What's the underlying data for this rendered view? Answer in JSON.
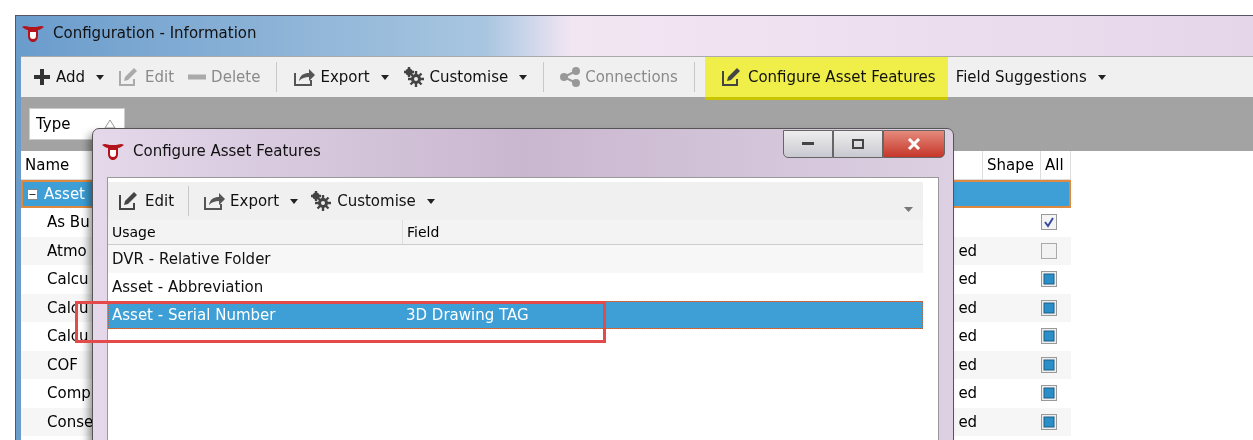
{
  "main_window": {
    "title": "Configuration - Information",
    "toolbar": [
      {
        "kind": "add",
        "label": "Add",
        "dropdown": true,
        "disabled": false,
        "highlighted": false
      },
      {
        "kind": "edit",
        "label": "Edit",
        "dropdown": false,
        "disabled": true,
        "highlighted": false
      },
      {
        "kind": "delete",
        "label": "Delete",
        "dropdown": false,
        "disabled": true,
        "highlighted": false
      },
      {
        "kind": "separator"
      },
      {
        "kind": "export",
        "label": "Export",
        "dropdown": true,
        "disabled": false,
        "highlighted": false
      },
      {
        "kind": "customise",
        "label": "Customise",
        "dropdown": true,
        "disabled": false,
        "highlighted": false
      },
      {
        "kind": "separator"
      },
      {
        "kind": "connections",
        "label": "Connections",
        "dropdown": false,
        "disabled": true,
        "highlighted": false
      },
      {
        "kind": "separator"
      },
      {
        "kind": "configure",
        "label": "Configure Asset Features",
        "dropdown": false,
        "disabled": false,
        "highlighted": true
      },
      {
        "kind": "plain",
        "label": "Field Suggestions",
        "dropdown": true,
        "disabled": false,
        "highlighted": false
      }
    ],
    "group_by": {
      "label": "Type"
    },
    "columns": [
      {
        "kind": "name",
        "label": "Name"
      },
      {
        "kind": "shape",
        "label": "Shape"
      },
      {
        "kind": "all",
        "label": "All"
      }
    ],
    "group_row": {
      "label": "Asset",
      "expanded": true,
      "selected": true
    },
    "rows": [
      {
        "name": "As Bu",
        "kind": "tick"
      },
      {
        "name": "Atmo",
        "column_3": "ed",
        "kind": "empty"
      },
      {
        "name": "Calcu",
        "column_3": "ed",
        "kind": "filled"
      },
      {
        "name": "Calcu",
        "column_3": "ed",
        "kind": "filled"
      },
      {
        "name": "Calcu",
        "column_3": "ed",
        "kind": "filled"
      },
      {
        "name": "COF",
        "column_3": "ed",
        "kind": "filled"
      },
      {
        "name": "Comp",
        "column_3": "ed",
        "kind": "filled"
      },
      {
        "name": "Conse",
        "column_3": "ed",
        "kind": "filled"
      }
    ]
  },
  "dialog": {
    "title": "Configure Asset Features",
    "toolbar": [
      {
        "kind": "edit",
        "label": "Edit",
        "dropdown": false
      },
      {
        "kind": "separator"
      },
      {
        "kind": "export",
        "label": "Export",
        "dropdown": true
      },
      {
        "kind": "customise",
        "label": "Customise",
        "dropdown": true
      }
    ],
    "columns": [
      "Usage",
      "Field"
    ],
    "rows": [
      {
        "usage": "DVR - Relative Folder",
        "selected": false,
        "outlined": false
      },
      {
        "usage": "Asset - Abbreviation",
        "selected": false,
        "outlined": false
      },
      {
        "usage": "Asset - Serial Number",
        "field": "3D Drawing TAG",
        "selected": true,
        "outlined": true
      }
    ]
  }
}
